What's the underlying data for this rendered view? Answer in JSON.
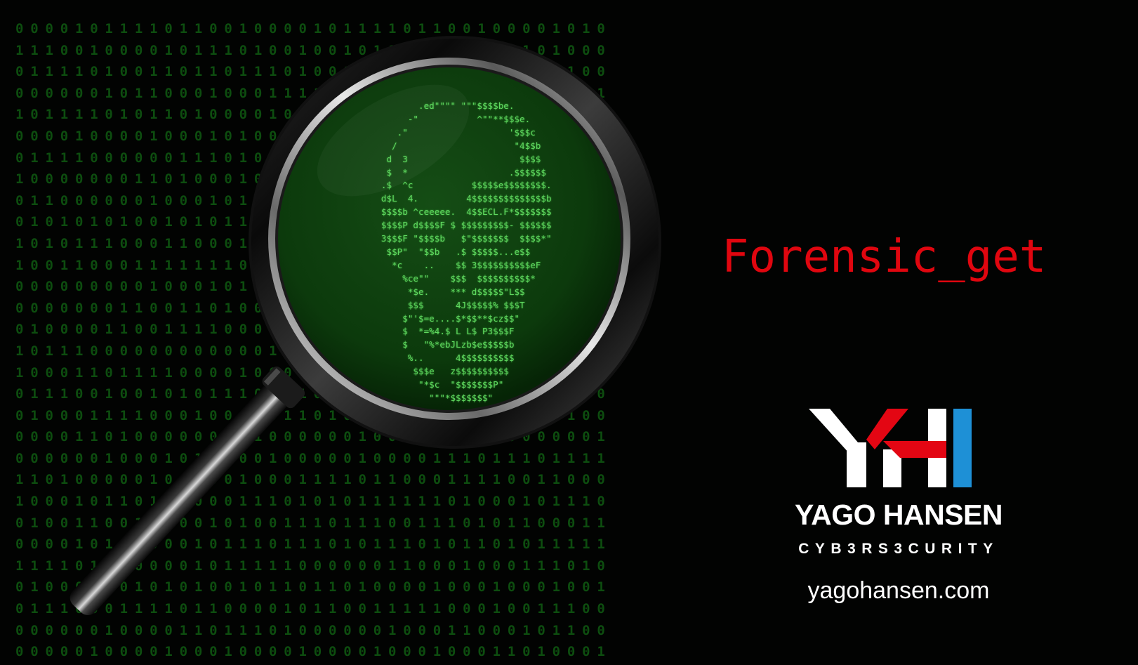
{
  "title": "Forensic_get",
  "brand": {
    "name": "YAGO HANSEN",
    "tagline": "CYB3RS3CURITY",
    "url": "yagohansen.com",
    "logo_text": "YH",
    "logo_colors": {
      "white": "#ffffff",
      "red": "#e30613",
      "blue": "#1e90d6"
    }
  },
  "colors": {
    "background": "#020302",
    "binary_digits": "#0f5a12",
    "lens": "#0c3a0c",
    "ascii_art": "#5fd95f",
    "title": "#e0060f"
  },
  "ascii_art": "            .ed\"\"\"\" \"\"\"$$$$be.\n          -\"           ^\"\"**$$$e.\n        .\"                   '$$$c\n       /                      \"4$$b\n      d  3                     $$$$\n      $  *                   .$$$$$$\n     .$  ^c           $$$$$e$$$$$$$$.\n     d$L  4.         4$$$$$$$$$$$$$$b\n     $$$$b ^ceeeee.  4$$ECL.F*$$$$$$$\n     $$$$P d$$$$F $ $$$$$$$$$- $$$$$$\n     3$$$F \"$$$$b   $\"$$$$$$$  $$$$*\"\n      $$P\"  \"$$b   .$ $$$$$...e$$\n       *c    ..    $$ 3$$$$$$$$$$eF\n         %ce\"\"    $$$  $$$$$$$$$$*\n          *$e.    *** d$$$$$\"L$$\n          $$$      4J$$$$$% $$$T\n         $\"'$=e....$*$$**$cz$$\"\n         $  *=%4.$ L L$ P3$$$F\n         $   \"%*ebJLzb$e$$$$$b\n          %..      4$$$$$$$$$$\n           $$$e   z$$$$$$$$$$\n            \"*$c  \"$$$$$$$P\"\n              \"\"\"*$$$$$$$\"",
  "binary_rows": [
    "0000101111011001000010111101100100001010",
    "1110010000101110100100101111011100101000",
    "0111101001101101110100100101111101000100",
    "0000001011000100011110101001001101000101",
    "1011110101101000010101101111101110111011",
    "0000100001000101000110011101000110110010",
    "0111100000011101001011000011111100001000",
    "1000000011010001000011100011110000011110",
    "0110000001000101011101011101000011000110",
    "0101010100101011111110111001011100110000",
    "1010111000110001011100000110001100001011",
    "1001100011111110110001100110010010101101",
    "0000000001000101110010000110000100001000",
    "0000000110011010001000000010101111100111",
    "0100001100111100001011111011011000110011",
    "1011100000000000010111101101110100110101",
    "1000110111100001000110000001101000101100",
    "0111001001010111001101101010101010001000",
    "0100011110001001101101000101110110001100",
    "0000110100000011100000010000011100000001",
    "0000001000101000010000010000111011101111",
    "1101000001011001000111101100011110011000",
    "1000101101100001110101011111101000101110",
    "0100110011100101001110111001110101100011",
    "0000101010001011101110101110101101011111",
    "1111010000001011111000000110001000111010",
    "0100010010101001011011010000100010001001",
    "0111000111101100001011001111100010011100",
    "0000001000011011101000000100011000101100",
    "0000010000100010000100001000100011010001"
  ]
}
